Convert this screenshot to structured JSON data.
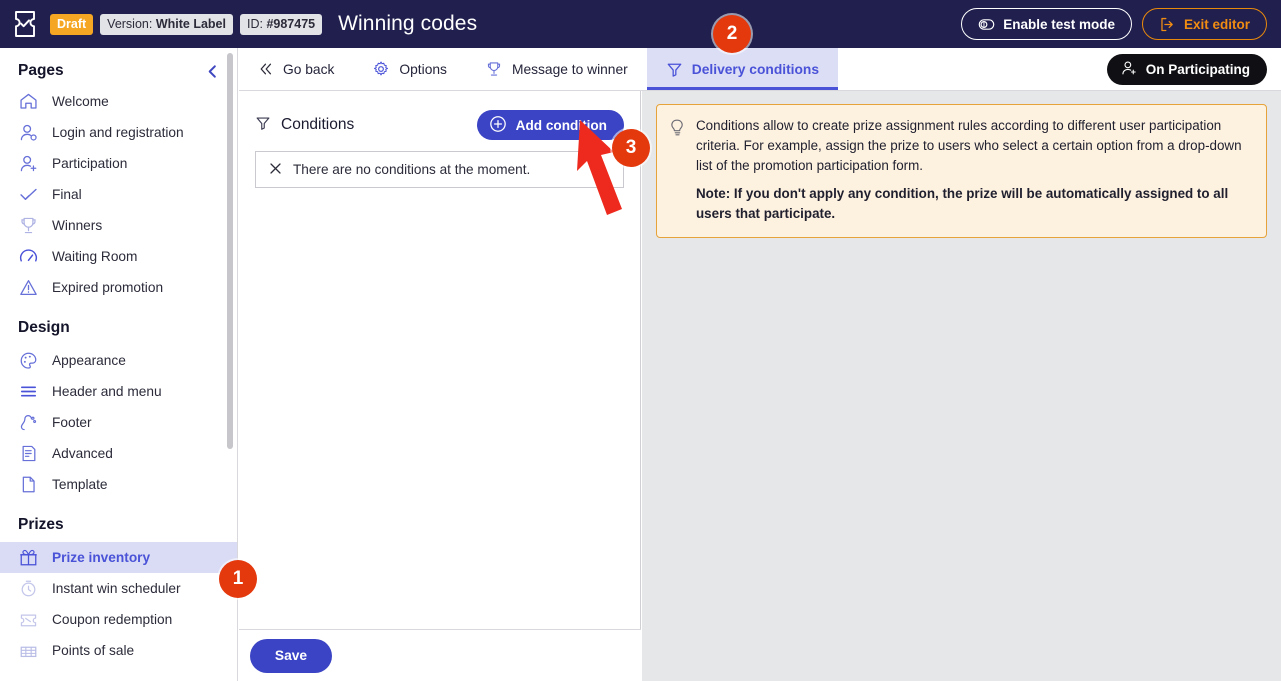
{
  "header": {
    "logo_icon": "ticket-check-icon",
    "status_badge": "Draft",
    "version_label": "Version:",
    "version_value": "White Label",
    "id_label": "ID:",
    "id_value": "#987475",
    "title": "Winning codes",
    "test_mode_label": "Enable test mode",
    "test_mode_icon": "toggle-icon",
    "exit_editor_label": "Exit editor",
    "exit_editor_icon": "logout-icon",
    "bg_color": "#201f4e",
    "draft_color": "#f5a623",
    "exit_color": "#f08c12"
  },
  "sidebar": {
    "pages_title": "Pages",
    "collapse_icon": "chevron-left-icon",
    "pages": [
      {
        "label": "Welcome",
        "icon": "home-icon"
      },
      {
        "label": "Login and registration",
        "icon": "user-login-icon"
      },
      {
        "label": "Participation",
        "icon": "user-add-icon"
      },
      {
        "label": "Final",
        "icon": "check-icon"
      },
      {
        "label": "Winners",
        "icon": "trophy-icon"
      },
      {
        "label": "Waiting Room",
        "icon": "speedometer-icon"
      },
      {
        "label": "Expired promotion",
        "icon": "warning-triangle-icon"
      }
    ],
    "design_title": "Design",
    "design": [
      {
        "label": "Appearance",
        "icon": "palette-icon"
      },
      {
        "label": "Header and menu",
        "icon": "menu-lines-icon"
      },
      {
        "label": "Footer",
        "icon": "footer-icon"
      },
      {
        "label": "Advanced",
        "icon": "document-code-icon"
      },
      {
        "label": "Template",
        "icon": "page-icon"
      }
    ],
    "prizes_title": "Prizes",
    "prizes": [
      {
        "label": "Prize inventory",
        "icon": "gift-icon",
        "active": true
      },
      {
        "label": "Instant win scheduler",
        "icon": "stopwatch-icon",
        "active": false
      },
      {
        "label": "Coupon redemption",
        "icon": "coupon-icon",
        "active": false
      },
      {
        "label": "Points of sale",
        "icon": "store-icon",
        "active": false
      }
    ],
    "active_color": "#4a52d8",
    "active_bg": "#d9dcf4"
  },
  "tabs": [
    {
      "label": "Go back",
      "icon": "double-chevron-left-icon",
      "active": false
    },
    {
      "label": "Options",
      "icon": "gear-icon",
      "active": false
    },
    {
      "label": "Message to winner",
      "icon": "trophy-icon",
      "active": false
    },
    {
      "label": "Delivery conditions",
      "icon": "filter-icon",
      "active": true
    }
  ],
  "participating_badge": {
    "label": "On Participating",
    "icon": "user-add-icon"
  },
  "conditions_panel": {
    "title": "Conditions",
    "title_icon": "filter-icon",
    "add_button_label": "Add condition",
    "add_button_icon": "plus-circle-icon",
    "empty_icon": "close-x-icon",
    "empty_message": "There are no conditions at the moment.",
    "save_label": "Save",
    "accent_color": "#3b44c4"
  },
  "info_callout": {
    "icon": "lightbulb-icon",
    "body": "Conditions allow to create prize assignment rules according to different user participation criteria. For example, assign the prize to users who select a certain option from a drop-down list of the promotion participation form.",
    "note": "Note: If you don't apply any condition, the prize will be automatically assigned to all users that participate.",
    "border_color": "#e6a33a",
    "bg_color": "#fdf1e0"
  },
  "annotations": {
    "marker_color": "#e4380d",
    "markers": [
      {
        "number": "1",
        "target": "sidebar-item-prize-inventory"
      },
      {
        "number": "2",
        "target": "tab-delivery-conditions"
      },
      {
        "number": "3",
        "target": "add-condition-button"
      }
    ],
    "arrow_icon": "red-arrow-icon"
  }
}
